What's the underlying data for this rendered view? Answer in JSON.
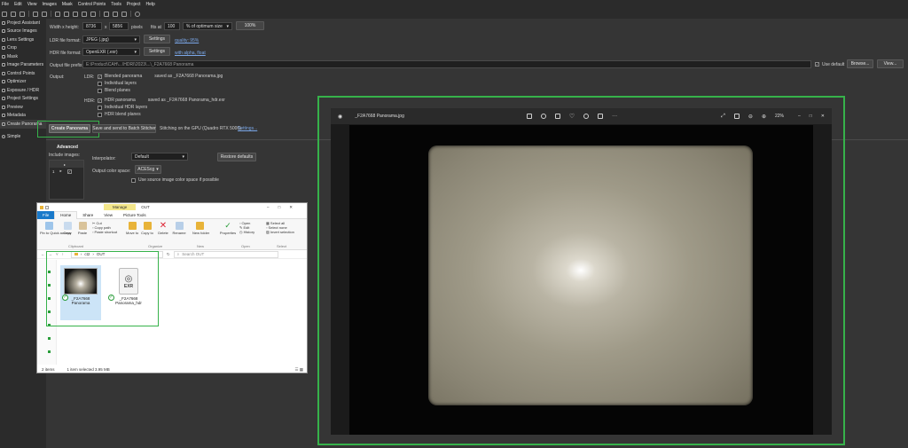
{
  "menu": [
    "File",
    "Edit",
    "View",
    "Images",
    "Mask",
    "Control Points",
    "Tools",
    "Project",
    "Help"
  ],
  "sidebar": {
    "items": [
      {
        "label": "Project Assistant"
      },
      {
        "label": "Source Images"
      },
      {
        "label": "Lens Settings"
      },
      {
        "label": "Crop"
      },
      {
        "label": "Mask"
      },
      {
        "label": "Image Parameters"
      },
      {
        "label": "Control Points"
      },
      {
        "label": "Optimizer"
      },
      {
        "label": "Exposure / HDR"
      },
      {
        "label": "Project Settings"
      },
      {
        "label": "Preview"
      },
      {
        "label": "Metadata"
      },
      {
        "label": "Create Panorama"
      },
      {
        "label": "Simple"
      }
    ]
  },
  "output": {
    "wh_label": "Width x height:",
    "width": "8736",
    "x": "x",
    "height": "5856",
    "pixels": "pixels",
    "fit_label": "fits at",
    "fit_value": "100",
    "size_mode": "% of optimum size",
    "size_pct": "100%",
    "ldr_label": "LDR file format:",
    "ldr_format": "JPEG (.jpg)",
    "ldr_settings": "Settings",
    "ldr_quality": "quality: 95%",
    "hdr_label": "HDR file format:",
    "hdr_format": "OpenEXR (.exr)",
    "hdr_settings": "Settings",
    "hdr_alpha": "with alpha, float",
    "prefix_label": "Output file prefix:",
    "prefix_value": "E:\\Product\\CAH\\...\\HDRI\\2023\\...\\_F2A7668 Panorama",
    "use_default": "Use default",
    "browse": "Browse...",
    "view": "View...",
    "output_label": "Output:",
    "ldr_tag": "LDR:",
    "blended": "Blended panorama",
    "blended_saved": "saved as _F2A7668 Panorama.jpg",
    "indiv_layers": "Individual layers",
    "blend_planes": "Blend planes",
    "hdr_tag": "HDR:",
    "hdr_pano": "HDR panorama",
    "hdr_saved": "saved as _F2A7668 Panorama_hdr.exr",
    "indiv_hdr": "Individual HDR layers",
    "hdr_blend_planes": "HDR blend planes",
    "create_btn": "Create Panorama",
    "save_batch": "Save and send to Batch Stitcher",
    "gpu_text": "Stitching on the GPU (Quadro RTX 5000).",
    "gpu_link": "Settings...",
    "advanced": "Advanced",
    "include_images": "Include images:",
    "table_row_num": "1",
    "interp_label": "Interpolator:",
    "interp_value": "Default",
    "restore": "Restore defaults",
    "colorspace_label": "Output color space:",
    "colorspace_value": "ACEScg",
    "use_source": "Use source image color space if possible"
  },
  "explorer": {
    "manage_tab": "Manage",
    "folder_title": "OUT",
    "tabs": [
      "File",
      "Home",
      "Share",
      "View",
      "Picture Tools"
    ],
    "ribbon": {
      "pin": "Pin to Quick access",
      "copy": "Copy",
      "paste": "Paste",
      "cut": "Cut",
      "copy_path": "Copy path",
      "paste_shortcut": "Paste shortcut",
      "move_to": "Move to",
      "copy_to": "Copy to",
      "delete": "Delete",
      "rename": "Rename",
      "new_folder": "New folder",
      "properties": "Properties",
      "open": "Open",
      "edit": "Edit",
      "history": "History",
      "select_all": "Select all",
      "select_none": "Select none",
      "invert": "Invert selection",
      "group_clipboard": "Clipboard",
      "group_organize": "Organize",
      "group_new": "New",
      "group_open": "Open",
      "group_select": "Select"
    },
    "path": [
      "ct2",
      "OUT"
    ],
    "search_placeholder": "Search OUT",
    "files": [
      {
        "name": "_F2A7668 Panorama"
      },
      {
        "name": "_F2A7668 Panorama_hdr",
        "badge": "EXR"
      }
    ],
    "status_items": "2 items",
    "status_selected": "1 item selected  3.95 MB"
  },
  "viewer": {
    "filename": "_F2A7668 Panorama.jpg",
    "zoom": "22%"
  }
}
